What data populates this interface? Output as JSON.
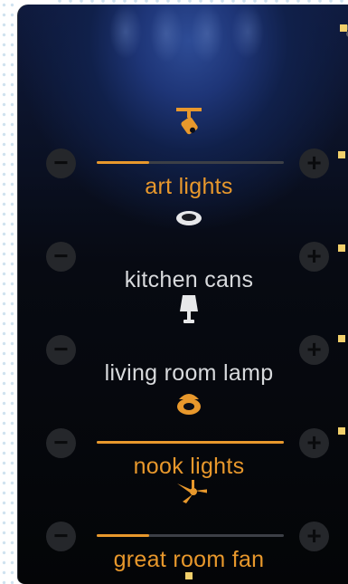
{
  "colors": {
    "accent": "#e8982c",
    "off_text": "#d8dadd",
    "button": "#25272b",
    "track": "#3c3f46"
  },
  "devices": [
    {
      "name": "art lights",
      "icon": "track-light-icon",
      "level": 0.28,
      "on": true,
      "has_slider": true
    },
    {
      "name": "kitchen cans",
      "icon": "recessed-can-icon",
      "level": 0,
      "on": false,
      "has_slider": false
    },
    {
      "name": "living room lamp",
      "icon": "table-lamp-icon",
      "level": 0,
      "on": false,
      "has_slider": false
    },
    {
      "name": "nook lights",
      "icon": "ceiling-light-icon",
      "level": 1.0,
      "on": true,
      "has_slider": true
    },
    {
      "name": "great room fan",
      "icon": "ceiling-fan-icon",
      "level": 0.28,
      "on": true,
      "has_slider": true
    }
  ],
  "controls": {
    "minus": "−",
    "plus": "+"
  }
}
